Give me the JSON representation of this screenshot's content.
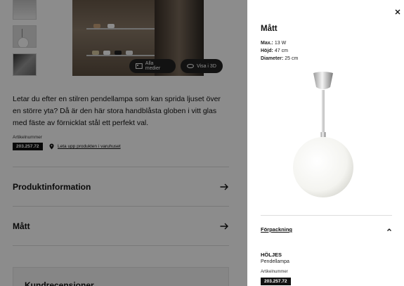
{
  "product": {
    "description": "Letar du efter en stilren pendellampa som kan sprida ljuset över en större yta? Då är den här stora handblåsta globen i vitt glas med fäste av förnicklat stål ett perfekt val.",
    "article_label": "Artikelnummer",
    "article_number": "203.257.72",
    "store_link": "Leta upp produkten i varuhuset"
  },
  "media": {
    "all_media_label": "Alla medier",
    "view_3d_label": "Visa i 3D"
  },
  "accordions": {
    "product_info": "Produktinformation",
    "measurements": "Mått",
    "reviews": "Kundrecensioner"
  },
  "panel": {
    "title": "Mått",
    "specs": {
      "max_label": "Max.:",
      "max_value": "13 W",
      "height_label": "Höjd:",
      "height_value": "47 cm",
      "diameter_label": "Diameter:",
      "diameter_value": "25 cm"
    },
    "packaging_label": "Förpackning",
    "package": {
      "name": "HÖLJES",
      "type": "Pendellampa",
      "article_label": "Artikelnummer",
      "article_number": "203.257.72"
    }
  },
  "colors": {
    "overlay": "#000000",
    "badge": "#111111"
  }
}
